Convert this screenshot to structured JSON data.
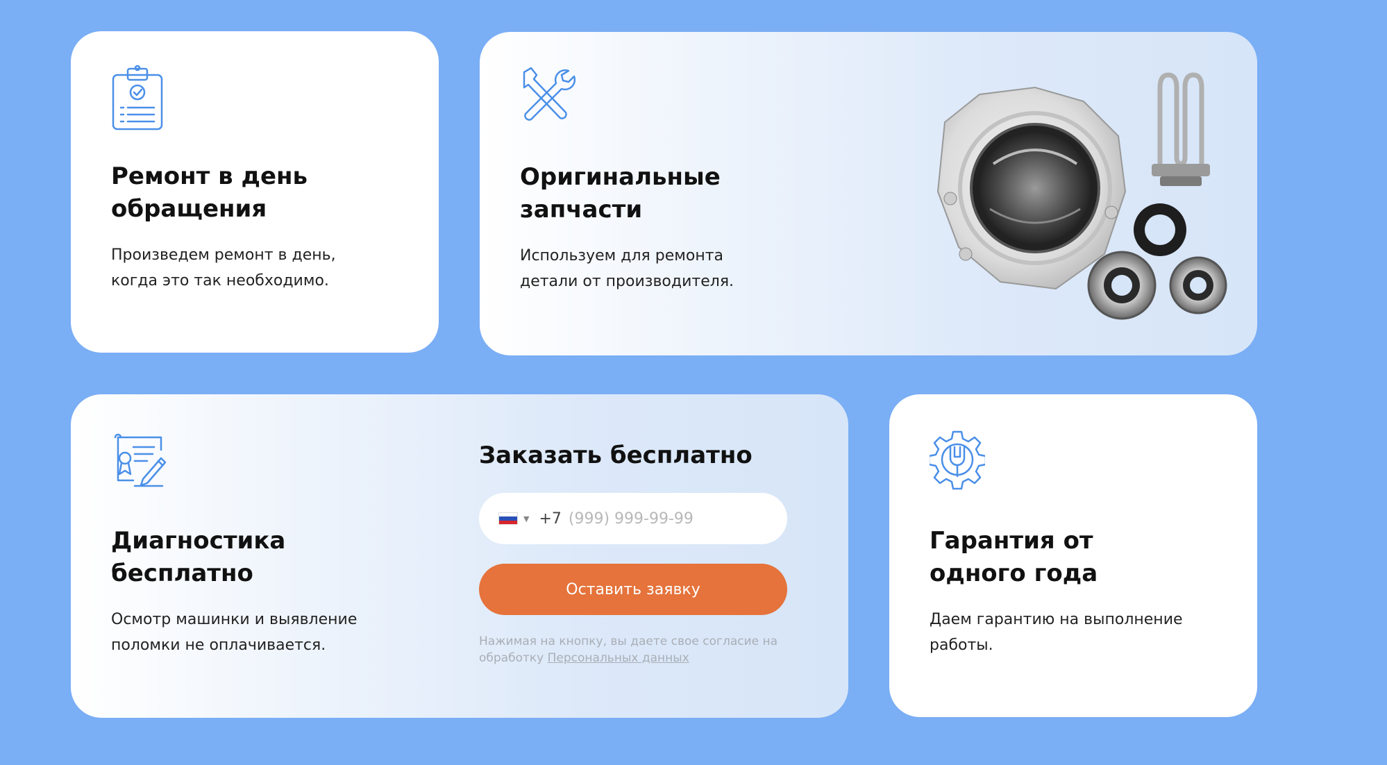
{
  "colors": {
    "background": "#7aaef5",
    "card": "#ffffff",
    "accent_icon": "#4a8fe8",
    "button": "#e5733b",
    "button_text": "#ffffff",
    "muted_text": "#a9aeb6"
  },
  "cards": [
    {
      "icon": "clipboard-check-icon",
      "title": "Ремонт в день обращения",
      "text": "Произведем ремонт в день, когда это так необходимо."
    },
    {
      "icon": "wrench-screwdriver-icon",
      "title": "Оригинальные запчасти",
      "text": "Используем для ремонта детали от производителя.",
      "illustration": "washing-machine-parts-image"
    },
    {
      "icon": "certificate-pen-icon",
      "title": "Диагностика бесплатно",
      "text": "Осмотр машинки и выявление поломки не оплачивается."
    },
    {
      "icon": "gear-wrench-icon",
      "title": "Гарантия от одного года",
      "text": "Даем гарантию на выполнение работы."
    }
  ],
  "order_form": {
    "title": "Заказать бесплатно",
    "country_flag": "russia-flag-icon",
    "phone_prefix": "+7",
    "phone_placeholder": "(999) 999-99-99",
    "submit_label": "Оставить заявку",
    "consent_text": "Нажимая на кнопку, вы даете свое согласие на обработку",
    "consent_link": "Персональных данных"
  }
}
